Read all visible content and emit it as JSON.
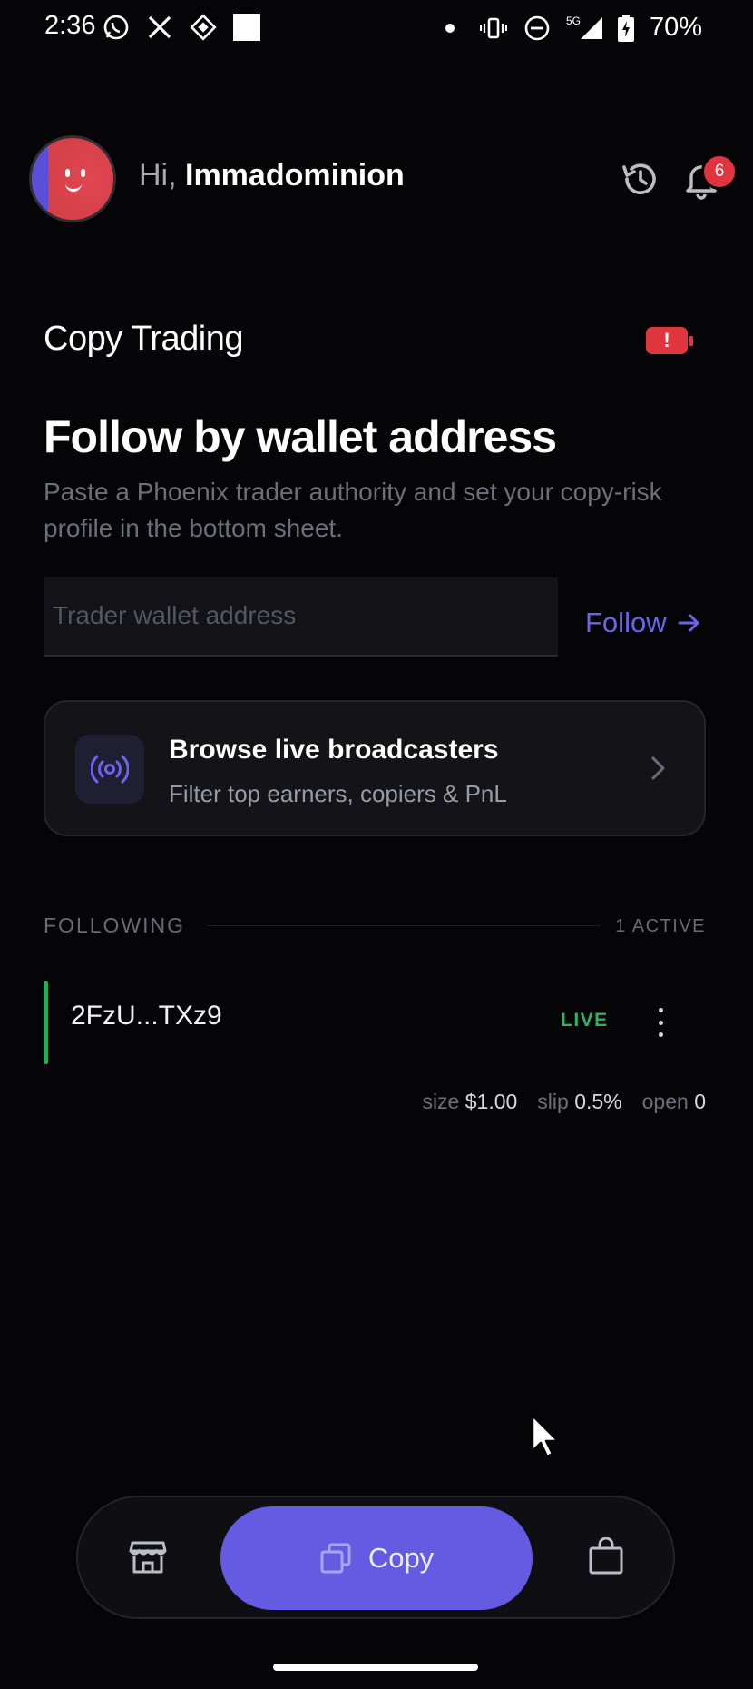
{
  "status_bar": {
    "time": "2:36",
    "battery": "70%",
    "network": "5G",
    "left_icons": [
      "whatsapp-icon",
      "x-icon",
      "app-icon",
      "square-icon"
    ],
    "right_icons": [
      "dot-icon",
      "vibrate-icon",
      "dnd-icon",
      "signal-icon",
      "battery-charging-icon"
    ]
  },
  "header": {
    "greeting_prefix": "Hi, ",
    "user_name": "Immadominion",
    "notification_count": "6"
  },
  "page": {
    "title": "Copy Trading",
    "alert_symbol": "!"
  },
  "follow_section": {
    "heading": "Follow by wallet address",
    "description": "Paste a Phoenix trader authority and set your copy-risk profile in the bottom sheet.",
    "input_placeholder": "Trader wallet address",
    "input_value": "",
    "follow_label": "Follow"
  },
  "browse_card": {
    "title": "Browse live broadcasters",
    "subtitle": "Filter top earners, copiers & PnL"
  },
  "following": {
    "label": "FOLLOWING",
    "active_count": "1 ACTIVE",
    "traders": [
      {
        "name": "2FzU...TXz9",
        "status": "LIVE",
        "size_label": "size",
        "size_value": "$1.00",
        "slip_label": "slip",
        "slip_value": "0.5%",
        "open_label": "open",
        "open_value": "0"
      }
    ]
  },
  "bottom_nav": {
    "copy_label": "Copy",
    "items": [
      "store-icon",
      "copy-icon",
      "bag-icon"
    ]
  },
  "colors": {
    "background": "#050507",
    "accent": "#645be2",
    "accent_text": "#6c63ec",
    "live_green": "#2fb364",
    "alert_red": "#e0343f"
  }
}
